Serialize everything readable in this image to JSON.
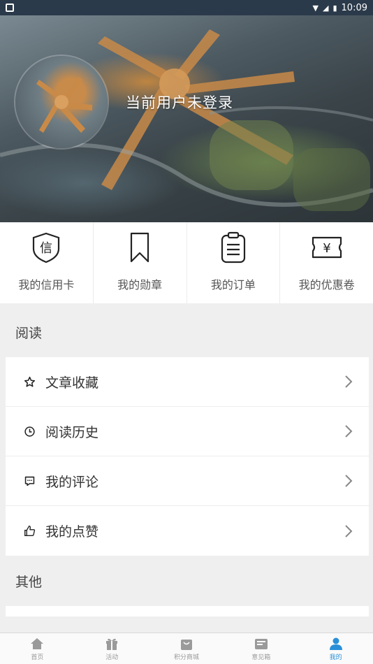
{
  "status_bar": {
    "time": "10:09"
  },
  "header": {
    "login_prompt": "当前用户未登录"
  },
  "quick_actions": [
    {
      "label": "我的信用卡",
      "icon": "credit-shield-icon",
      "glyph": "信"
    },
    {
      "label": "我的勋章",
      "icon": "bookmark-icon"
    },
    {
      "label": "我的订单",
      "icon": "clipboard-icon"
    },
    {
      "label": "我的优惠卷",
      "icon": "coupon-yen-icon",
      "glyph": "¥"
    }
  ],
  "sections": {
    "reading": {
      "title": "阅读",
      "items": [
        {
          "label": "文章收藏",
          "icon": "star-icon"
        },
        {
          "label": "阅读历史",
          "icon": "clock-icon"
        },
        {
          "label": "我的评论",
          "icon": "comment-icon"
        },
        {
          "label": "我的点赞",
          "icon": "thumbs-up-icon"
        }
      ]
    },
    "other": {
      "title": "其他"
    }
  },
  "bottom_nav": [
    {
      "label": "首页",
      "icon": "home-icon"
    },
    {
      "label": "活动",
      "icon": "gift-icon"
    },
    {
      "label": "积分商城",
      "icon": "shopping-bag-icon"
    },
    {
      "label": "意见箱",
      "icon": "inbox-icon"
    },
    {
      "label": "我的",
      "icon": "user-icon",
      "active": true
    }
  ],
  "colors": {
    "accent": "#2a8fd8",
    "status_bar": "#2b3a4a"
  }
}
